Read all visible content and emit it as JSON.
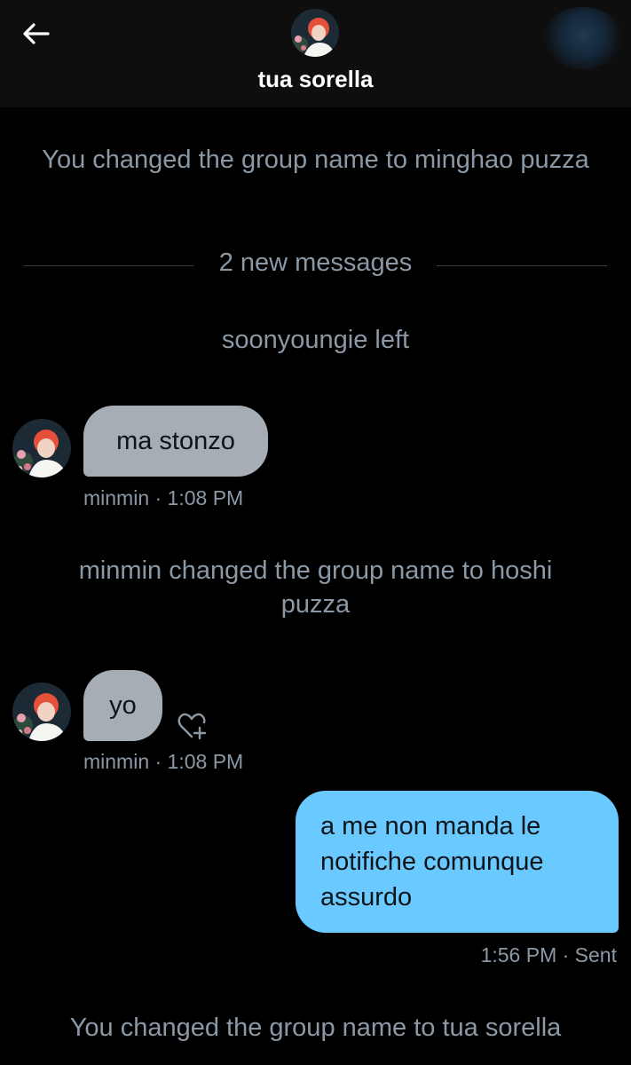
{
  "header": {
    "title": "tua sorella",
    "back_icon": "arrow-left-icon",
    "avatar_icon": "group-avatar"
  },
  "timeline": {
    "system_1": "You changed the group name to minghao puzza",
    "new_messages_divider": "2 new messages",
    "system_2": "soonyoungie left",
    "system_3": "minmin changed the group name to hoshi puzza",
    "system_4": "You changed the group name to tua sorella"
  },
  "messages": [
    {
      "sender": "minmin",
      "text": "ma stonzo",
      "meta": "minmin · 1:08 PM"
    },
    {
      "sender": "minmin",
      "text": "yo",
      "meta": "minmin · 1:08 PM",
      "reaction_icon": "heart-plus-icon"
    },
    {
      "sender": "You",
      "text": "a me non manda le notifiche comunque assurdo",
      "meta": "1:56 PM · Sent"
    }
  ],
  "colors": {
    "incoming_bubble": "#a7adb4",
    "outgoing_bubble": "#6ac9ff",
    "meta_text": "#8b98a5",
    "background": "#000000"
  }
}
